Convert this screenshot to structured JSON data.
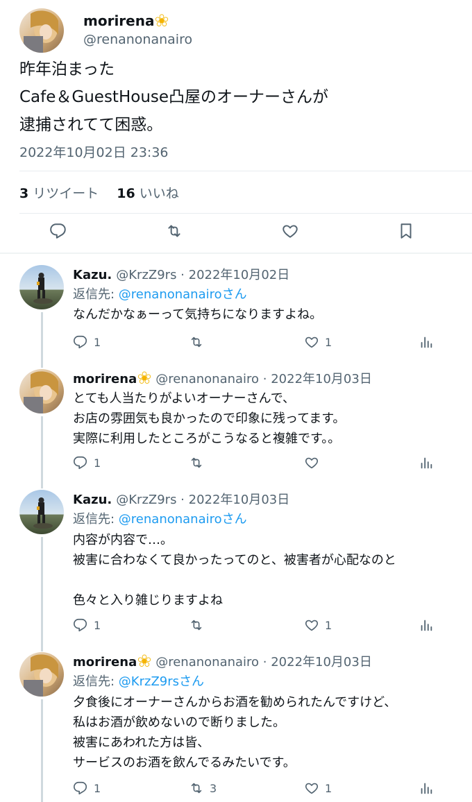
{
  "main_tweet": {
    "author_name": "morirena",
    "author_handle": "@renanonanairo",
    "text_lines": [
      "昨年泊まった",
      "Cafe＆GuestHouse凸屋のオーナーさんが",
      "逮捕されてて困惑。"
    ],
    "timestamp": "2022年10月02日 23:36",
    "retweet_count": "3",
    "retweet_label": "リツイート",
    "like_count": "16",
    "like_label": "いいね"
  },
  "replies": [
    {
      "name": "Kazu.",
      "meta": "@KrzZ9rs · 2022年10月02日",
      "replying_prefix": "返信先: ",
      "replying_to": "@renanonanairoさん",
      "text_lines": [
        "なんだかなぁーって気持ちになりますよね。"
      ],
      "reply_count": "1",
      "retweet_count": "",
      "like_count": "1"
    },
    {
      "name": "morirena",
      "meta": "@renanonanairo · 2022年10月03日",
      "replying_prefix": "",
      "replying_to": "",
      "text_lines": [
        "とても人当たりがよいオーナーさんで、",
        "お店の雰囲気も良かったので印象に残ってます。",
        "実際に利用したところがこうなると複雑です。。"
      ],
      "reply_count": "1",
      "retweet_count": "",
      "like_count": ""
    },
    {
      "name": "Kazu.",
      "meta": "@KrzZ9rs · 2022年10月03日",
      "replying_prefix": "返信先: ",
      "replying_to": "@renanonanairoさん",
      "text_lines": [
        "内容が内容で…。",
        "被害に合わなくて良かったってのと、被害者が心配なのと",
        "",
        "色々と入り雑じりますよね"
      ],
      "reply_count": "1",
      "retweet_count": "",
      "like_count": "1"
    },
    {
      "name": "morirena",
      "meta": "@renanonanairo · 2022年10月03日",
      "replying_prefix": "返信先: ",
      "replying_to": "@KrzZ9rsさん",
      "text_lines": [
        "夕食後にオーナーさんからお酒を勧められたんですけど、",
        "私はお酒が飲めないので断りました。",
        "被害にあわれた方は皆、",
        "サービスのお酒を飲んでるみたいです。"
      ],
      "reply_count": "1",
      "retweet_count": "3",
      "like_count": "1"
    }
  ],
  "icons": {
    "reply": "reply-icon",
    "retweet": "retweet-icon",
    "like": "heart-icon",
    "bookmark": "bookmark-icon",
    "analytics": "analytics-icon",
    "flower": "flower-emoji-icon"
  },
  "colors": {
    "text": "#0f1419",
    "secondary": "#536471",
    "link": "#1d9bf0",
    "divider": "#eff3f4"
  }
}
